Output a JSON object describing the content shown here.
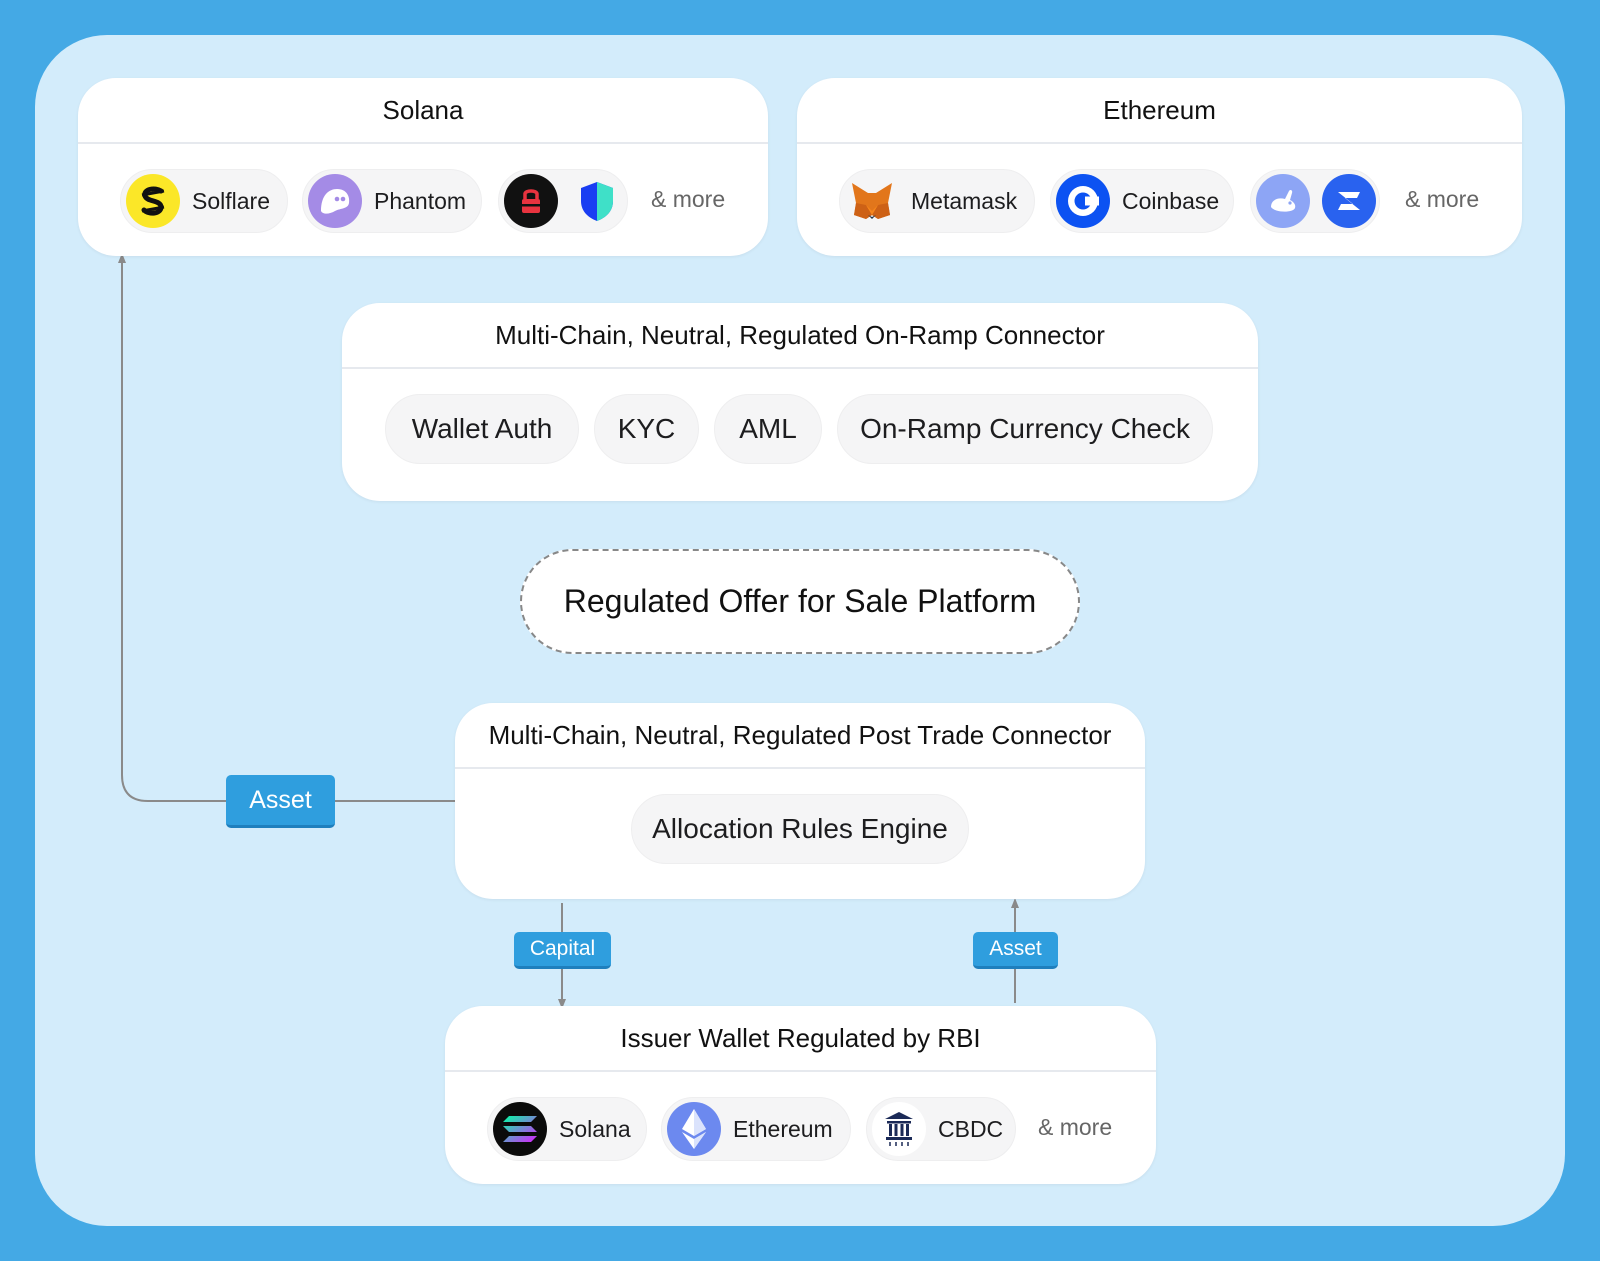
{
  "solana_card": {
    "title": "Solana",
    "wallets": [
      {
        "label": "Solflare",
        "icon": "solflare-icon"
      },
      {
        "label": "Phantom",
        "icon": "phantom-icon"
      }
    ],
    "extra_icons": [
      "lock-icon",
      "shield-icon"
    ],
    "more": "& more"
  },
  "ethereum_card": {
    "title": "Ethereum",
    "wallets": [
      {
        "label": "Metamask",
        "icon": "metamask-fox-icon"
      },
      {
        "label": "Coinbase",
        "icon": "coinbase-icon"
      }
    ],
    "extra_icons": [
      "rabbit-icon",
      "zerion-icon"
    ],
    "more": "& more"
  },
  "onramp": {
    "title": "Multi-Chain, Neutral, Regulated On-Ramp Connector",
    "items": [
      "Wallet Auth",
      "KYC",
      "AML",
      "On-Ramp Currency Check"
    ]
  },
  "platform": {
    "label": "Regulated Offer for Sale Platform"
  },
  "post_trade": {
    "title": "Multi-Chain, Neutral, Regulated Post Trade Connector",
    "items": [
      "Allocation Rules Engine"
    ]
  },
  "issuer": {
    "title": "Issuer Wallet Regulated by RBI",
    "chains": [
      {
        "label": "Solana",
        "icon": "solana-icon"
      },
      {
        "label": "Ethereum",
        "icon": "ethereum-icon"
      },
      {
        "label": "CBDC",
        "icon": "cbdc-bank-icon"
      }
    ],
    "more": "& more"
  },
  "flows": {
    "asset_left": "Asset",
    "capital": "Capital",
    "asset_right": "Asset"
  },
  "colors": {
    "outer_bg": "#44a9e5",
    "canvas_bg": "#d3ecfb",
    "tag_bg": "#2f9ede"
  }
}
